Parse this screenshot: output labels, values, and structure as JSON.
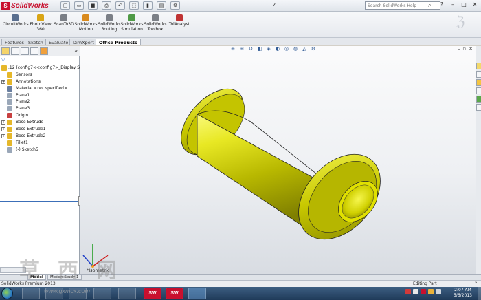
{
  "app": {
    "brand": "SolidWorks",
    "logo_mark": "S",
    "doc_title": ".12",
    "search_placeholder": "Search SolidWorks Help"
  },
  "commands": [
    {
      "label": "CircuitWorks",
      "color": "#5a6f8f"
    },
    {
      "label": "PhotoView\n360",
      "color": "#d9a516"
    },
    {
      "label": "ScanTo3D",
      "color": "#7b7f86"
    },
    {
      "label": "SolidWorks\nMotion",
      "color": "#d98a1e"
    },
    {
      "label": "SolidWorks\nRouting",
      "color": "#7b7f86"
    },
    {
      "label": "SolidWorks\nSimulation",
      "color": "#4f9a46"
    },
    {
      "label": "SolidWorks\nToolbox",
      "color": "#7b7f86"
    },
    {
      "label": "TolAnalyst",
      "color": "#c03434"
    }
  ],
  "tabs": [
    "Features",
    "Sketch",
    "Evaluate",
    "DimXpert",
    "Office Products"
  ],
  "active_tab": "Office Products",
  "tree": {
    "root": ".12  (config7<<config7>_Display St",
    "items": [
      {
        "label": "Sensors",
        "icon": "sensor-icon",
        "color": "#e5b72a",
        "expand": ""
      },
      {
        "label": "Annotations",
        "icon": "annotations-icon",
        "color": "#e5b72a",
        "expand": "+"
      },
      {
        "label": "Material <not specified>",
        "icon": "material-icon",
        "color": "#6a7fa0",
        "expand": ""
      },
      {
        "label": "Plane1",
        "icon": "plane-icon",
        "color": "#9aa7b8",
        "expand": ""
      },
      {
        "label": "Plane2",
        "icon": "plane-icon",
        "color": "#9aa7b8",
        "expand": ""
      },
      {
        "label": "Plane3",
        "icon": "plane-icon",
        "color": "#9aa7b8",
        "expand": ""
      },
      {
        "label": "Origin",
        "icon": "origin-icon",
        "color": "#c84040",
        "expand": ""
      },
      {
        "label": "Base-Extrude",
        "icon": "extrude-icon",
        "color": "#e5b72a",
        "expand": "+"
      },
      {
        "label": "Boss-Extrude1",
        "icon": "extrude-icon",
        "color": "#e5b72a",
        "expand": "+"
      },
      {
        "label": "Boss-Extrude2",
        "icon": "extrude-icon",
        "color": "#e5b72a",
        "expand": "+"
      },
      {
        "label": "Fillet1",
        "icon": "fillet-icon",
        "color": "#e5b72a",
        "expand": ""
      },
      {
        "label": "(-) Sketch5",
        "icon": "sketch-icon",
        "color": "#9aa7b8",
        "expand": ""
      }
    ]
  },
  "viewport": {
    "orientation": "*Isometric",
    "view_toolbar_icons": [
      "zoom-fit-icon",
      "zoom-area-icon",
      "previous-view-icon",
      "section-view-icon",
      "view-orientation-icon",
      "display-style-icon",
      "hide-show-icon",
      "edit-appearance-icon",
      "apply-scene-icon",
      "view-settings-icon"
    ],
    "model_color": "#d4d400"
  },
  "model_tabs": [
    "Model",
    "Motion Study 1"
  ],
  "status": {
    "product": "SolidWorks Premium 2013",
    "mode": "Editing Part",
    "help": "?"
  },
  "taskbar": {
    "time": "2:07 AM",
    "date": "5/6/2013",
    "sw_label": "SW"
  },
  "watermark": {
    "chars": "草西网",
    "url": "www.gxmcx.com"
  }
}
